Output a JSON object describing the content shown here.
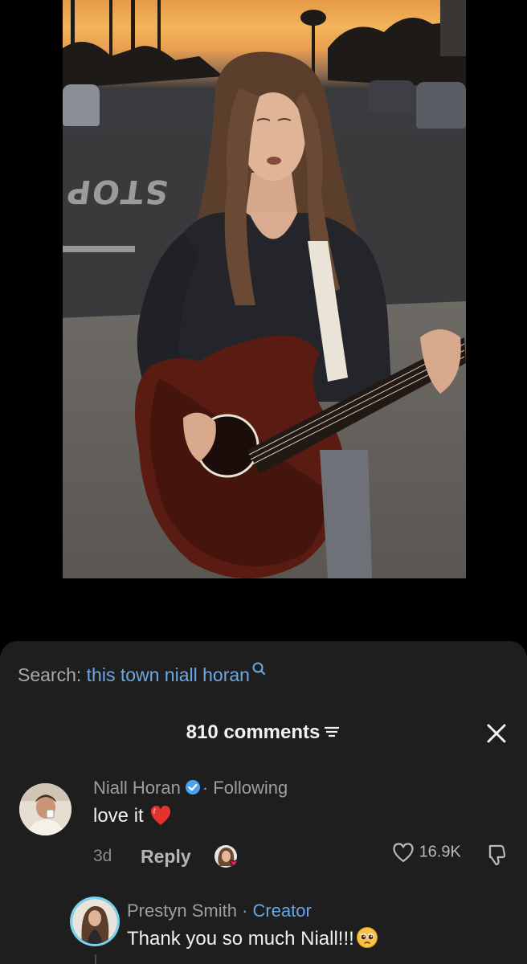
{
  "search": {
    "label": "Search:",
    "query": "this town niall horan"
  },
  "comments_header": {
    "count_label": "810 comments"
  },
  "comments": [
    {
      "author": "Niall Horan",
      "verified": true,
      "relation": "· Following",
      "text": "love it",
      "emoji": "red-heart",
      "age": "3d",
      "reply_label": "Reply",
      "likes": "16.9K"
    }
  ],
  "replies": [
    {
      "author": "Prestyn Smith",
      "badge": "· Creator",
      "text": "Thank you so much Niall!!!",
      "emoji": "pleading-face"
    }
  ],
  "colors": {
    "sheet_background": "#1e1e1f",
    "link_blue": "#6fa7e0",
    "verified_blue": "#4aa3f0",
    "like_heart_red": "#ee1d52",
    "creator_ring": "#78d3f2"
  },
  "icons": [
    "search-icon",
    "filter-icon",
    "close-icon",
    "verified-icon",
    "heart-outline-icon",
    "dislike-icon",
    "red-heart-emoji",
    "pleading-face-emoji"
  ]
}
